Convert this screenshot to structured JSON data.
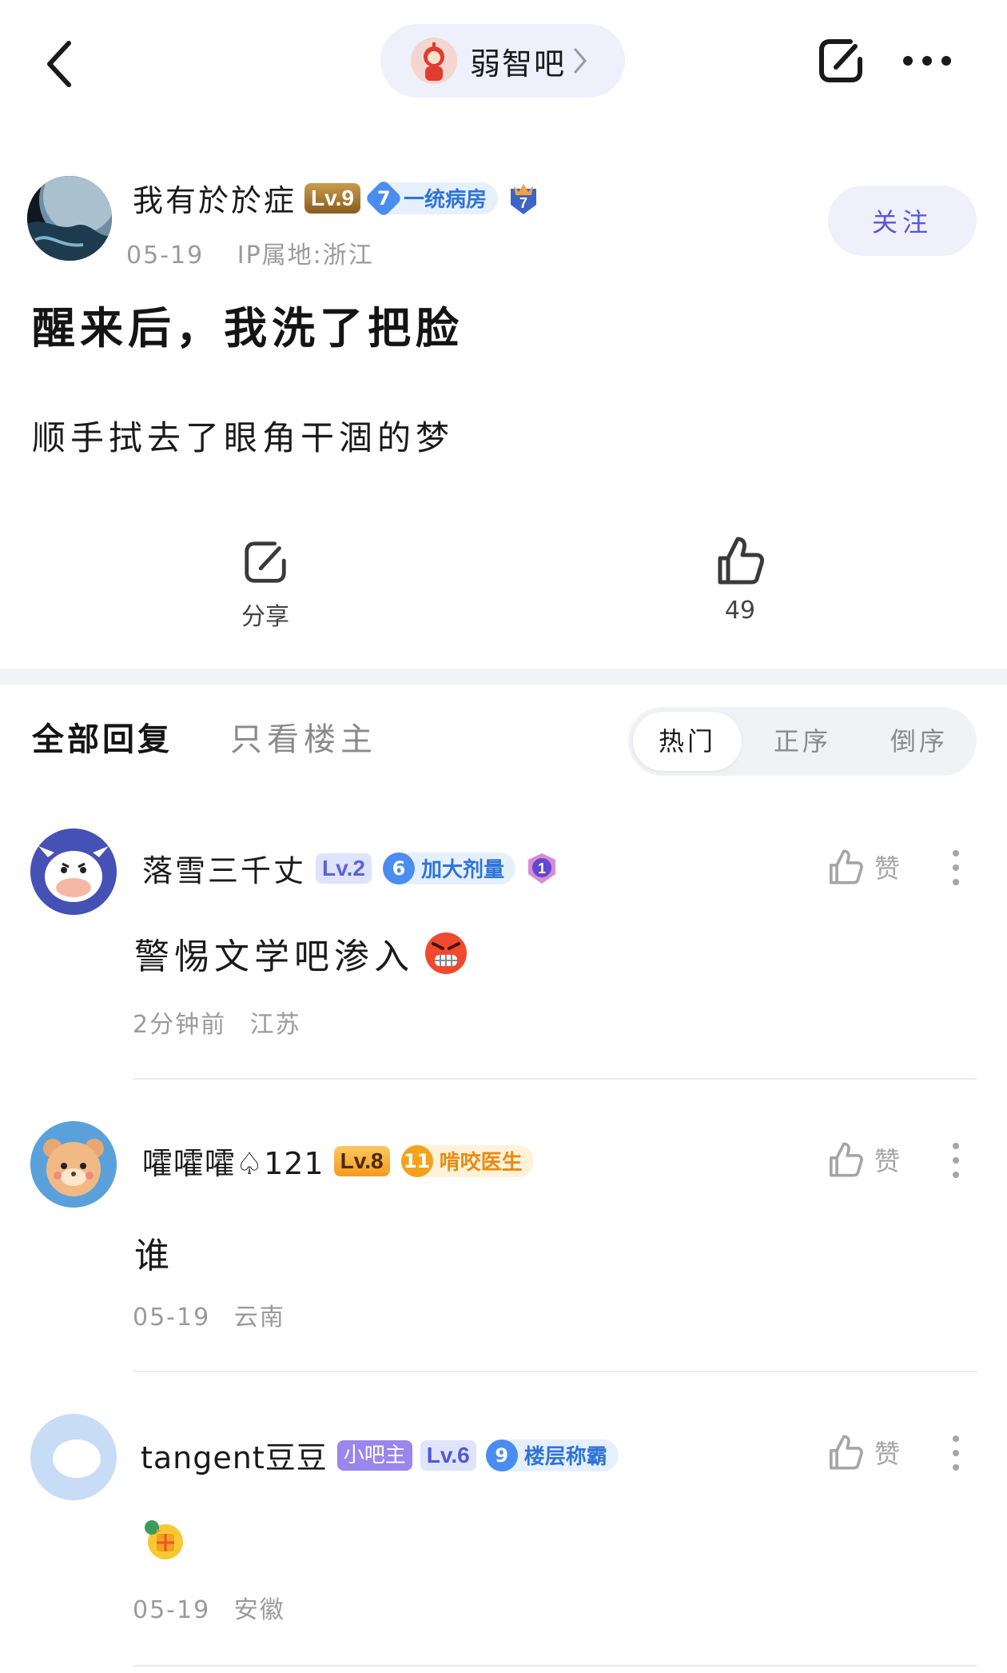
{
  "forum": {
    "name": "弱智吧"
  },
  "author": {
    "name": "我有於於症",
    "level": "Lv.9",
    "title_num": "7",
    "title": "一统病房",
    "medal_num": "7",
    "date": "05-19",
    "ip": "IP属地:浙江",
    "follow_label": "关注"
  },
  "post": {
    "title": "醒来后，我洗了把脸",
    "body": "顺手拭去了眼角干涸的梦"
  },
  "actions": {
    "share_label": "分享",
    "like_count": "49"
  },
  "tabs": {
    "all": "全部回复",
    "op_only": "只看楼主"
  },
  "sort": {
    "hot": "热门",
    "asc": "正序",
    "desc": "倒序"
  },
  "comments": [
    {
      "name": "落雪三千丈",
      "level": "Lv.2",
      "title_num": "6",
      "title": "加大剂量",
      "medal_num": "1",
      "text": "警惕文学吧渗入",
      "emoji": "angry-face-icon",
      "time": "2分钟前",
      "location": "江苏",
      "like_label": "赞"
    },
    {
      "name": "嚯嚯嚯♤121",
      "level": "Lv.8",
      "title_num": "11",
      "title": "啃咬医生",
      "text": "谁",
      "time": "05-19",
      "location": "云南",
      "like_label": "赞"
    },
    {
      "name": "tangent豆豆",
      "role": "小吧主",
      "level": "Lv.6",
      "title_num": "9",
      "title": "楼层称霸",
      "text": "",
      "emoji": "gift-bird-icon",
      "time": "05-19",
      "location": "安徽",
      "like_label": "赞"
    }
  ],
  "colors": {
    "accent": "#5a55d6",
    "blue_badge": "#4a8df0",
    "orange_badge": "#f4a21b",
    "purple_badge": "#8a78e8"
  }
}
